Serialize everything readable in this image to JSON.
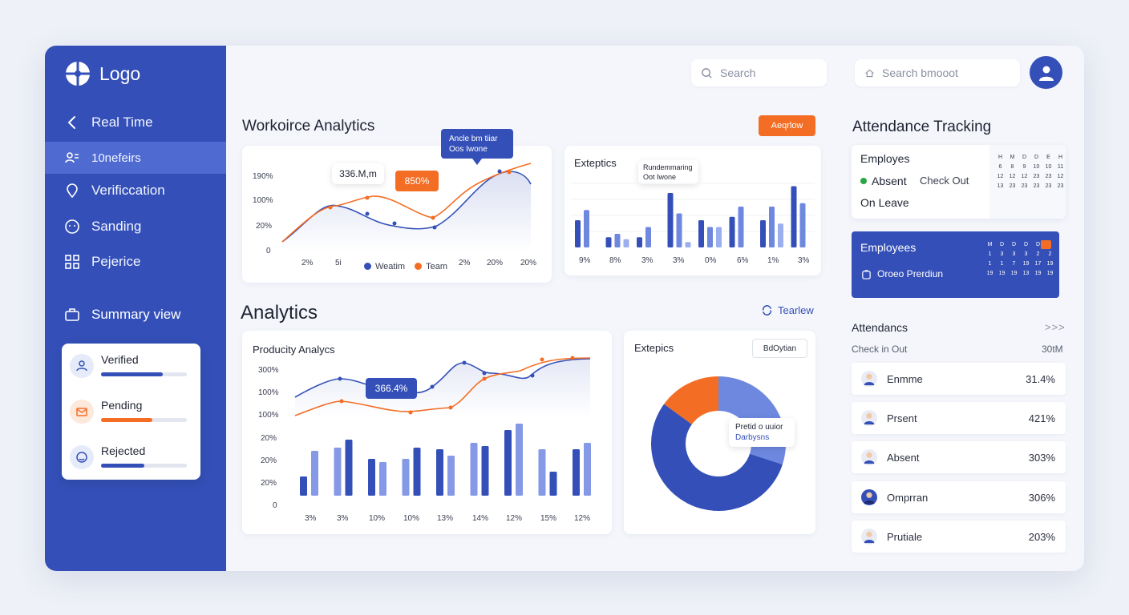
{
  "colors": {
    "primary": "#3450b8",
    "accent": "#f46d24",
    "light_blue": "#6e88e0"
  },
  "sidebar": {
    "logo": "Logo",
    "items": [
      {
        "label": "Real Time",
        "icon": "chevron-left-icon"
      },
      {
        "label": "10nefeirs",
        "icon": "users-icon"
      },
      {
        "label": "Verificcation",
        "icon": "location-pin-icon"
      },
      {
        "label": "Sanding",
        "icon": "smile-icon"
      },
      {
        "label": "Pejerice",
        "icon": "grid-icon"
      }
    ],
    "summary_title": "Summary view",
    "summary": [
      {
        "label": "Verified",
        "progress": 0.72
      },
      {
        "label": "Pending",
        "progress": 0.6
      },
      {
        "label": "Rejected",
        "progress": 0.5
      }
    ]
  },
  "header": {
    "search_placeholder": "Search",
    "search2_placeholder": "Search bmooot"
  },
  "workforce": {
    "title": "Workoirce Analytics",
    "button": "Aeqrlow",
    "card1": {
      "y_ticks": [
        "190%",
        "100%",
        "20%",
        "0"
      ],
      "x_ticks": [
        "2%",
        "5i",
        "2%",
        "20%",
        "20%"
      ],
      "tooltip1": "336.M,m",
      "tooltip2": "850%",
      "tooltip3_line1": "Ancle bm tiiar",
      "tooltip3_line2": "Oos Iwone",
      "legend": [
        "Weatim",
        "Team"
      ]
    },
    "card2": {
      "title": "Exteptics",
      "tooltip_line1": "Rundemmaring",
      "tooltip_line2": "Oot Iwone",
      "x_ticks": [
        "9%",
        "8%",
        "3%",
        "3%",
        "0%",
        "6%",
        "1%",
        "3%"
      ]
    }
  },
  "analytics": {
    "title": "Analytics",
    "link": "Tearlew",
    "productivity": {
      "title": "Producity Analycs",
      "y_ticks": [
        "300%",
        "100%",
        "100%",
        "20%",
        "20%",
        "20%",
        "0"
      ],
      "x_ticks": [
        "3%",
        "3%",
        "10%",
        "10%",
        "13%",
        "14%",
        "12%",
        "15%",
        "12%"
      ],
      "tooltip": "366.4%"
    },
    "donut": {
      "title": "Extepics",
      "button": "BdOytian",
      "tooltip_line1": "Pretid o uuior",
      "tooltip_line2": "Darbysns"
    }
  },
  "attendance": {
    "title": "Attendance Tracking",
    "card": {
      "employees": "Employes",
      "absent": "Absent",
      "checkout": "Check Out",
      "onleave": "On Leave",
      "cal": [
        "H",
        "M",
        "D",
        "D",
        "E",
        "H",
        "6",
        "8",
        "9",
        "10",
        "10",
        "11",
        "12",
        "12",
        "12",
        "23",
        "23",
        "12",
        "13",
        "23",
        "23",
        "23",
        "23",
        "23"
      ]
    },
    "emp_card": {
      "title": "Employees",
      "sub": "Oroeo Prerdiun",
      "cal": [
        "M",
        "D",
        "D",
        "D",
        "D",
        "",
        "1",
        "3",
        "3",
        "3",
        "2",
        "2",
        "1",
        "1",
        "7",
        "19",
        "17",
        "19",
        "19",
        "19",
        "19",
        "13",
        "19",
        "19"
      ]
    },
    "list_title": "Attendancs",
    "list_sub": "Check in Out",
    "list_sub_value": "30tM",
    "rows": [
      {
        "name": "Enmme",
        "value": "31.4%"
      },
      {
        "name": "Prsent",
        "value": "421%"
      },
      {
        "name": "Absent",
        "value": "303%"
      },
      {
        "name": "Omprran",
        "value": "306%"
      },
      {
        "name": "Prutiale",
        "value": "203%"
      }
    ]
  },
  "chart_data": [
    {
      "type": "line",
      "title": "",
      "x": [
        "2%",
        "5i",
        "2%",
        "20%",
        "20%"
      ],
      "series": [
        {
          "name": "Weatim",
          "values": [
            20,
            110,
            60,
            30,
            130,
            150
          ]
        },
        {
          "name": "Team",
          "values": [
            20,
            100,
            110,
            60,
            140,
            155
          ]
        }
      ],
      "ylim": [
        0,
        190
      ]
    },
    {
      "type": "bar",
      "title": "Exteptics",
      "categories": [
        "9%",
        "8%",
        "3%",
        "3%",
        "0%",
        "6%",
        "1%",
        "3%"
      ],
      "series": [
        {
          "values": [
            40,
            15,
            15,
            80,
            40,
            45,
            40,
            90
          ]
        },
        {
          "values": [
            55,
            20,
            30,
            50,
            30,
            60,
            60,
            65
          ]
        },
        {
          "values": [
            0,
            12,
            0,
            8,
            30,
            0,
            35,
            0
          ]
        }
      ]
    },
    {
      "type": "bar",
      "title": "Producity Analycs",
      "categories": [
        "3%",
        "3%",
        "10%",
        "10%",
        "13%",
        "14%",
        "12%",
        "15%",
        "12%"
      ],
      "series": [
        {
          "values": [
            12,
            30,
            23,
            23,
            29,
            33,
            41,
            29,
            29
          ]
        },
        {
          "values": [
            28,
            35,
            21,
            30,
            25,
            31,
            45,
            15,
            33
          ]
        }
      ],
      "lines": [
        {
          "values": [
            220,
            250,
            215,
            210,
            260,
            245,
            280,
            282
          ]
        },
        {
          "values": [
            160,
            170,
            165,
            150,
            175,
            230,
            270,
            280
          ]
        }
      ]
    },
    {
      "type": "pie",
      "title": "Extepics",
      "slices": [
        {
          "label": "blue-dark",
          "value": 55
        },
        {
          "label": "blue-light",
          "value": 30
        },
        {
          "label": "orange",
          "value": 15
        }
      ]
    }
  ]
}
